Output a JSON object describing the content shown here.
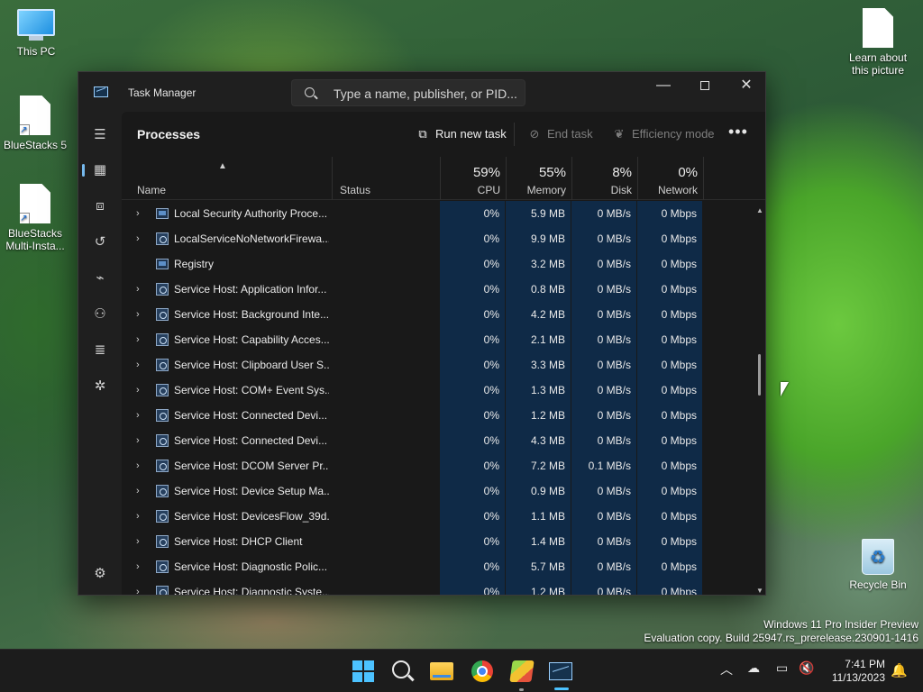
{
  "desktop": {
    "icons": [
      {
        "label": "This PC"
      },
      {
        "label": "BlueStacks 5"
      },
      {
        "label": "BlueStacks Multi-Insta..."
      },
      {
        "label": "Learn about this picture"
      },
      {
        "label": "Recycle Bin"
      }
    ],
    "watermark": {
      "line1": "Windows 11 Pro Insider Preview",
      "line2": "Evaluation copy. Build 25947.rs_prerelease.230901-1416"
    }
  },
  "window": {
    "title": "Task Manager",
    "search_placeholder": "Type a name, publisher, or PID...",
    "controls": {
      "minimize": "—",
      "close": "✕"
    }
  },
  "toolbar": {
    "page_title": "Processes",
    "run_new_task": "Run new task",
    "end_task": "End task",
    "efficiency_mode": "Efficiency mode",
    "more": "•••"
  },
  "columns": {
    "name": "Name",
    "status": "Status",
    "cpu": {
      "label": "CPU",
      "pct": "59%"
    },
    "memory": {
      "label": "Memory",
      "pct": "55%"
    },
    "disk": {
      "label": "Disk",
      "pct": "8%"
    },
    "network": {
      "label": "Network",
      "pct": "0%"
    }
  },
  "rows": [
    {
      "name": "Local Security Authority Proce...",
      "cpu": "0%",
      "memory": "5.9 MB",
      "disk": "0 MB/s",
      "network": "0 Mbps",
      "expand": "›",
      "icon": "box"
    },
    {
      "name": "LocalServiceNoNetworkFirewa...",
      "cpu": "0%",
      "memory": "9.9 MB",
      "disk": "0 MB/s",
      "network": "0 Mbps",
      "expand": "›",
      "icon": "gear"
    },
    {
      "name": "Registry",
      "cpu": "0%",
      "memory": "3.2 MB",
      "disk": "0 MB/s",
      "network": "0 Mbps",
      "expand": "",
      "icon": "box"
    },
    {
      "name": "Service Host: Application Infor...",
      "cpu": "0%",
      "memory": "0.8 MB",
      "disk": "0 MB/s",
      "network": "0 Mbps",
      "expand": "›",
      "icon": "gear"
    },
    {
      "name": "Service Host: Background Inte...",
      "cpu": "0%",
      "memory": "4.2 MB",
      "disk": "0 MB/s",
      "network": "0 Mbps",
      "expand": "›",
      "icon": "gear"
    },
    {
      "name": "Service Host: Capability Acces...",
      "cpu": "0%",
      "memory": "2.1 MB",
      "disk": "0 MB/s",
      "network": "0 Mbps",
      "expand": "›",
      "icon": "gear"
    },
    {
      "name": "Service Host: Clipboard User S...",
      "cpu": "0%",
      "memory": "3.3 MB",
      "disk": "0 MB/s",
      "network": "0 Mbps",
      "expand": "›",
      "icon": "gear"
    },
    {
      "name": "Service Host: COM+ Event Sys...",
      "cpu": "0%",
      "memory": "1.3 MB",
      "disk": "0 MB/s",
      "network": "0 Mbps",
      "expand": "›",
      "icon": "gear"
    },
    {
      "name": "Service Host: Connected Devi...",
      "cpu": "0%",
      "memory": "1.2 MB",
      "disk": "0 MB/s",
      "network": "0 Mbps",
      "expand": "›",
      "icon": "gear"
    },
    {
      "name": "Service Host: Connected Devi...",
      "cpu": "0%",
      "memory": "4.3 MB",
      "disk": "0 MB/s",
      "network": "0 Mbps",
      "expand": "›",
      "icon": "gear"
    },
    {
      "name": "Service Host: DCOM Server Pr...",
      "cpu": "0%",
      "memory": "7.2 MB",
      "disk": "0.1 MB/s",
      "network": "0 Mbps",
      "expand": "›",
      "icon": "gear"
    },
    {
      "name": "Service Host: Device Setup Ma...",
      "cpu": "0%",
      "memory": "0.9 MB",
      "disk": "0 MB/s",
      "network": "0 Mbps",
      "expand": "›",
      "icon": "gear"
    },
    {
      "name": "Service Host: DevicesFlow_39d...",
      "cpu": "0%",
      "memory": "1.1 MB",
      "disk": "0 MB/s",
      "network": "0 Mbps",
      "expand": "›",
      "icon": "gear"
    },
    {
      "name": "Service Host: DHCP Client",
      "cpu": "0%",
      "memory": "1.4 MB",
      "disk": "0 MB/s",
      "network": "0 Mbps",
      "expand": "›",
      "icon": "gear"
    },
    {
      "name": "Service Host: Diagnostic Polic...",
      "cpu": "0%",
      "memory": "5.7 MB",
      "disk": "0 MB/s",
      "network": "0 Mbps",
      "expand": "›",
      "icon": "gear"
    },
    {
      "name": "Service Host: Diagnostic Syste...",
      "cpu": "0%",
      "memory": "1.2 MB",
      "disk": "0 MB/s",
      "network": "0 Mbps",
      "expand": "›",
      "icon": "gear"
    }
  ],
  "taskbar": {
    "clock_time": "7:41 PM",
    "clock_date": "11/13/2023"
  },
  "colors": {
    "accent": "#4cc2ff",
    "highlight_column": "#0f2a47"
  }
}
